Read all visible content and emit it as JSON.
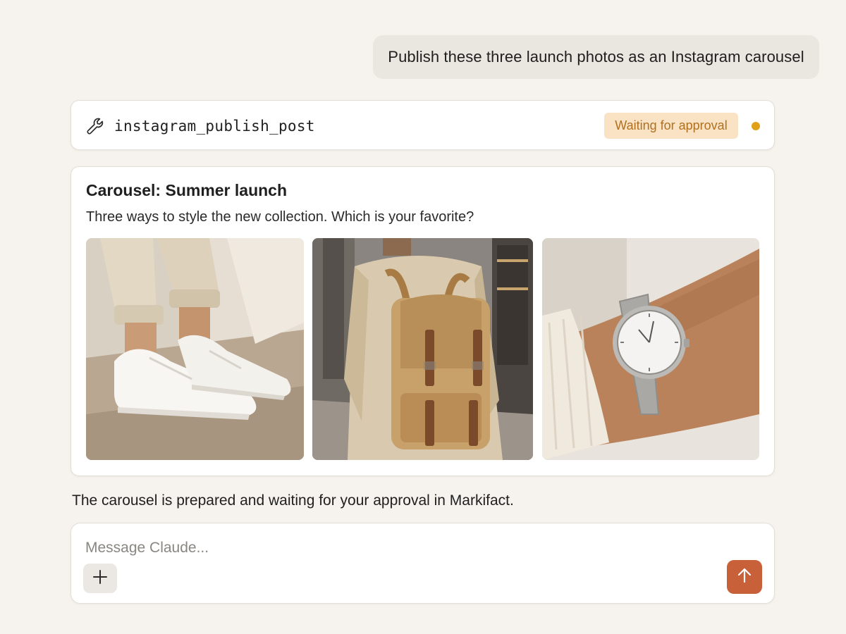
{
  "conversation": {
    "user_message": "Publish these three launch photos as an Instagram carousel"
  },
  "tool_call": {
    "icon": "wrench-icon",
    "name": "instagram_publish_post",
    "status": "Waiting for approval",
    "status_color": "#b0701e",
    "status_bg": "#fae3c4",
    "status_dot_color": "#e0a017"
  },
  "carousel": {
    "title": "Carousel: Summer launch",
    "caption": "Three ways to style the new collection. Which is your favorite?",
    "photos": [
      {
        "subject": "white-sneakers-photo"
      },
      {
        "subject": "canvas-backpack-photo"
      },
      {
        "subject": "silver-wristwatch-photo"
      }
    ]
  },
  "assistant": {
    "message": "The carousel is prepared and waiting for your approval in Markifact."
  },
  "composer": {
    "placeholder": "Message Claude...",
    "add_icon": "plus-icon",
    "send_icon": "arrow-up-icon",
    "send_color": "#c8603a"
  }
}
